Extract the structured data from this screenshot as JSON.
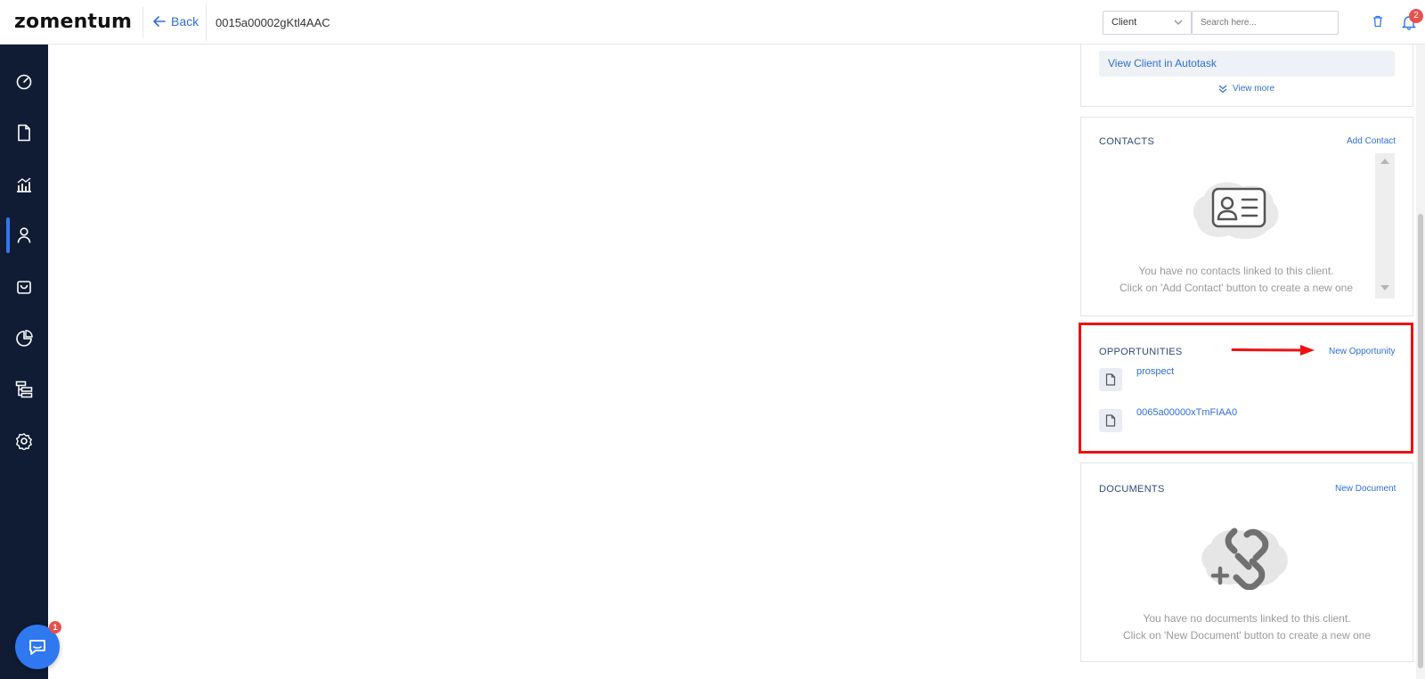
{
  "header": {
    "logo": "zomentum",
    "back_label": "Back",
    "record_id": "0015a00002gKtl4AAC",
    "entity_select": "Client",
    "search_placeholder": "Search here...",
    "notification_count": "2"
  },
  "sidebar": {
    "items": [
      {
        "name": "dashboard",
        "icon": "speedometer-icon"
      },
      {
        "name": "documents",
        "icon": "document-icon"
      },
      {
        "name": "analytics",
        "icon": "chart-icon"
      },
      {
        "name": "clients",
        "icon": "user-icon",
        "active": true
      },
      {
        "name": "marketplace",
        "icon": "bag-icon"
      },
      {
        "name": "reports",
        "icon": "pie-chart-icon"
      },
      {
        "name": "workflows",
        "icon": "hierarchy-icon"
      },
      {
        "name": "settings",
        "icon": "gear-icon"
      }
    ],
    "chat_badge": "1"
  },
  "client_card": {
    "autotask_link": "View Client in Autotask",
    "view_more": "View more"
  },
  "contacts": {
    "title": "CONTACTS",
    "action": "Add Contact",
    "empty_line1": "You have no contacts linked to this client.",
    "empty_line2": "Click on 'Add Contact' button to create a new one"
  },
  "opportunities": {
    "title": "OPPORTUNITIES",
    "action": "New Opportunity",
    "items": [
      {
        "label": "prospect"
      },
      {
        "label": "0065a00000xTmFIAA0"
      }
    ]
  },
  "documents": {
    "title": "DOCUMENTS",
    "action": "New Document",
    "empty_line1": "You have no documents linked to this client.",
    "empty_line2": "Click on 'New Document' button to create a new one"
  },
  "colors": {
    "sidebar_bg": "#0f1c33",
    "accent": "#2f78f0",
    "link": "#2e6ed6",
    "highlight_red": "#ee1111"
  }
}
